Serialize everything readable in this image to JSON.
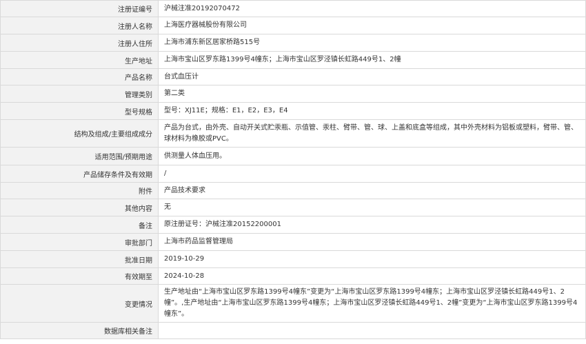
{
  "rows": [
    {
      "label": "注册证编号",
      "value": "沪械注准20192070472"
    },
    {
      "label": "注册人名称",
      "value": "上海医疗器械股份有限公司"
    },
    {
      "label": "注册人住所",
      "value": "上海市浦东新区居家桥路515号"
    },
    {
      "label": "生产地址",
      "value": "上海市宝山区罗东路1399号4幢东；上海市宝山区罗泾镇长虹路449号1、2幢"
    },
    {
      "label": "产品名称",
      "value": "台式血压计"
    },
    {
      "label": "管理类别",
      "value": "第二类"
    },
    {
      "label": "型号规格",
      "value": "型号：XJ11E；规格：E1，E2，E3，E4"
    },
    {
      "label": "结构及组成/主要组成成分",
      "value": "产品为台式，由外壳、自动开关式贮汞瓶、示值管、汞柱、臂带、管、球、上盖和底盒等组成，其中外壳材料为铝板或塑料，臂带、管、球材料为橡胶或PVC。"
    },
    {
      "label": "适用范围/预期用途",
      "value": "供测量人体血压用。"
    },
    {
      "label": "产品储存条件及有效期",
      "value": "/"
    },
    {
      "label": "附件",
      "value": "产品技术要求"
    },
    {
      "label": "其他内容",
      "value": "无"
    },
    {
      "label": "备注",
      "value": "原注册证号：沪械注准20152200001"
    },
    {
      "label": "审批部门",
      "value": "上海市药品监督管理局"
    },
    {
      "label": "批准日期",
      "value": "2019-10-29"
    },
    {
      "label": "有效期至",
      "value": "2024-10-28"
    },
    {
      "label": "变更情况",
      "value": "生产地址由“上海市宝山区罗东路1399号4幢东”变更为“上海市宝山区罗东路1399号4幢东；上海市宝山区罗泾镇长虹路449号1、2幢”。,生产地址由“上海市宝山区罗东路1399号4幢东；上海市宝山区罗泾镇长虹路449号1、2幢”变更为“上海市宝山区罗东路1399号4幢东”。"
    },
    {
      "label": "数据库相关备注",
      "value": ""
    }
  ]
}
